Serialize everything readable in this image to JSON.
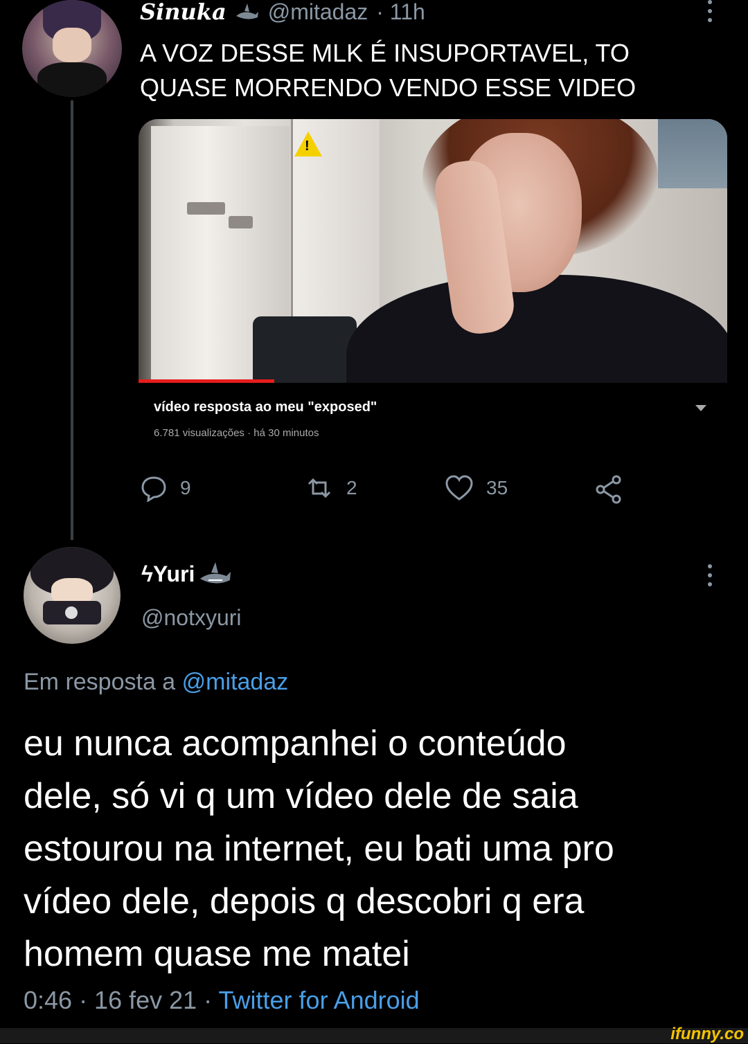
{
  "tweet1": {
    "display_name": "Sinuka",
    "handle": "@mitadaz",
    "time": "· 11h",
    "text_line1": "A VOZ DESSE MLK É INSUPORTAVEL, TO",
    "text_line2": "QUASE MORRENDO VENDO ESSE VIDEO",
    "media": {
      "video_title": "vídeo resposta ao meu \"exposed\"",
      "video_meta": "6.781 visualizações · há 30 minutos",
      "progress_fraction": 0.23
    },
    "actions": {
      "replies": "9",
      "retweets": "2",
      "likes": "35"
    }
  },
  "tweet2": {
    "display_name": "ϟYuri",
    "handle": "@notxyuri",
    "reply_prefix": "Em resposta a",
    "reply_to": "@mitadaz",
    "text_lines": [
      "eu nunca acompanhei o conteúdo",
      "dele, só vi q um vídeo dele de saia",
      "estourou na internet, eu bati uma pro",
      "vídeo dele, depois q descobri q era",
      "homem quase me matei"
    ],
    "timestamp": "0:46 · 16 fev 21 ·",
    "source": "Twitter for Android"
  },
  "watermark": "ifunny.co",
  "colors": {
    "background": "#000000",
    "secondary_text": "#8b98a5",
    "link": "#4a9fe8",
    "progress_red": "#e81c1c"
  },
  "icons": [
    "shark-emoji-icon",
    "more-icon",
    "reply-icon",
    "retweet-icon",
    "like-icon",
    "share-icon",
    "dropdown-icon"
  ]
}
